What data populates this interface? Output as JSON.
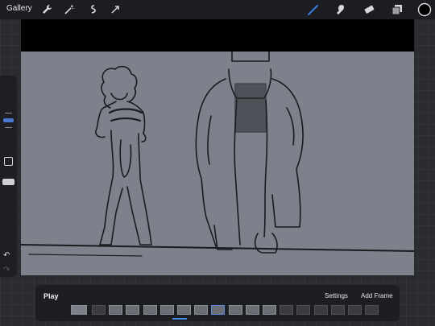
{
  "topbar": {
    "gallery_label": "Gallery",
    "tools": [
      {
        "name": "wrench-icon"
      },
      {
        "name": "magic-wand-icon"
      },
      {
        "name": "selection-icon"
      },
      {
        "name": "transform-icon"
      },
      {
        "name": "brush-icon",
        "active": true
      },
      {
        "name": "smudge-icon"
      },
      {
        "name": "eraser-icon"
      },
      {
        "name": "layers-icon"
      },
      {
        "name": "color-swatch-icon"
      }
    ],
    "active_tool_color": "#3d7be0",
    "current_color": "#000000"
  },
  "sidebar": {
    "undo_label": "↶",
    "redo_label": "↷"
  },
  "animation_bar": {
    "play_label": "Play",
    "settings_label": "Settings",
    "add_frame_label": "Add Frame",
    "frame_count": 18,
    "active_frame": 8
  },
  "colors": {
    "canvas": "#7c818c",
    "accent": "#3d7be0",
    "panel": "#1d1e21"
  }
}
